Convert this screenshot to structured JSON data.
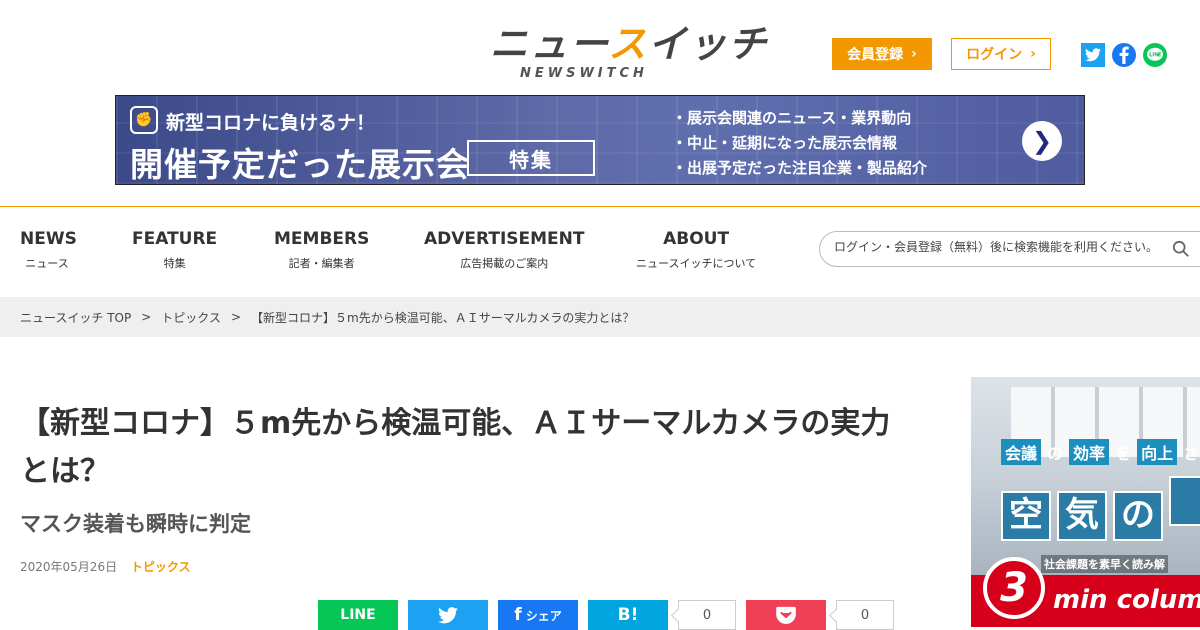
{
  "header": {
    "logo_jp_a": "ニュー",
    "logo_jp_b": "ス",
    "logo_jp_c": "イッチ",
    "logo_en": "NEWSWITCH",
    "register_label": "会員登録",
    "login_label": "ログイン",
    "chevron": "›"
  },
  "banner": {
    "line1": "新型コロナに負けるナ！",
    "line2": "開催予定だった展示会",
    "special": "特集",
    "bullets": [
      "・展示会関連のニュース・業界動向",
      "・中止・延期になった展示会情報",
      "・出展予定だった注目企業・製品紹介"
    ],
    "arrow": "❯"
  },
  "nav": {
    "items": [
      {
        "en": "NEWS",
        "jp": "ニュース"
      },
      {
        "en": "FEATURE",
        "jp": "特集"
      },
      {
        "en": "MEMBERS",
        "jp": "記者・編集者"
      },
      {
        "en": "ADVERTISEMENT",
        "jp": "広告掲載のご案内"
      },
      {
        "en": "ABOUT",
        "jp": "ニュースイッチについて"
      }
    ],
    "search_placeholder": "ログイン・会員登録（無料）後に検索機能を利用ください。"
  },
  "breadcrumb": {
    "items": [
      "ニュースイッチ TOP",
      "トピックス",
      "【新型コロナ】５m先から検温可能、ＡＩサーマルカメラの実力とは？"
    ],
    "separator": ">"
  },
  "article": {
    "title": "【新型コロナ】５m先から検温可能、ＡＩサーマルカメラの実力とは？",
    "subtitle": "マスク装着も瞬時に判定",
    "date": "2020年05月26日",
    "category": "トピックス"
  },
  "share": {
    "line": "LINE",
    "twitter_icon": "🐦",
    "facebook_f": "f",
    "facebook_label": "シェア",
    "hatena": "B!",
    "hatena_count": "0",
    "pocket_icon": "♡",
    "pocket_count": "0"
  },
  "side_ad": {
    "line1": [
      "会議",
      "の",
      "効率",
      "を",
      "向上",
      "さ"
    ],
    "line2": [
      "空",
      "気",
      "の",
      ""
    ],
    "line3": "社会課題を素早く読み解",
    "number": "3",
    "min_column": "min colum"
  },
  "colors": {
    "accent": "#f39800",
    "line": "#06c755",
    "twitter": "#1da1f2",
    "facebook": "#1877f2",
    "hatena": "#00a4de",
    "pocket": "#ef4056"
  }
}
